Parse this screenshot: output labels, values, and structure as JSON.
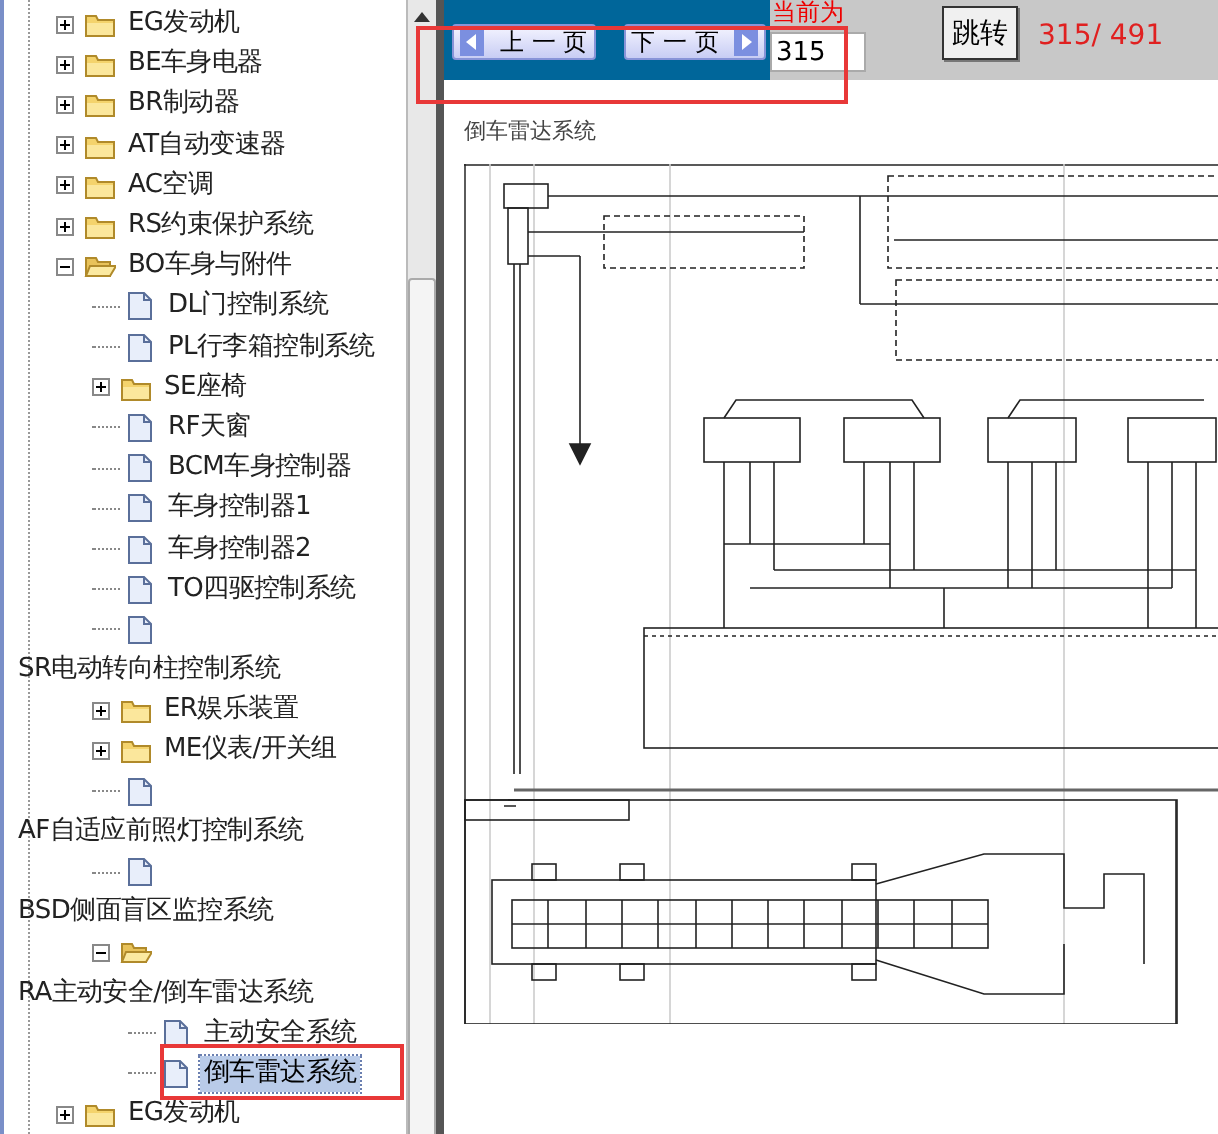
{
  "tree": {
    "items": [
      {
        "kind": "folder",
        "label": "EG发动机",
        "expanded": false,
        "selected": false
      },
      {
        "kind": "folder",
        "label": "BE车身电器",
        "expanded": false,
        "selected": false
      },
      {
        "kind": "folder",
        "label": "BR制动器",
        "expanded": false,
        "selected": false
      },
      {
        "kind": "folder",
        "label": "AT自动变速器",
        "expanded": false,
        "selected": false
      },
      {
        "kind": "folder",
        "label": "AC空调",
        "expanded": false,
        "selected": false
      },
      {
        "kind": "folder",
        "label": "RS约束保护系统",
        "expanded": false,
        "selected": false
      },
      {
        "kind": "folder",
        "label": "BO车身与附件",
        "expanded": true,
        "selected": false,
        "children": [
          {
            "kind": "doc",
            "label": "DL门控制系统",
            "selected": false
          },
          {
            "kind": "doc",
            "label": "PL行李箱控制系统",
            "selected": false
          },
          {
            "kind": "folder",
            "label": "SE座椅",
            "expanded": false,
            "selected": false
          },
          {
            "kind": "doc",
            "label": "RF天窗",
            "selected": false
          },
          {
            "kind": "doc",
            "label": "BCM车身控制器",
            "selected": false
          },
          {
            "kind": "doc",
            "label": "车身控制器1",
            "selected": false
          },
          {
            "kind": "doc",
            "label": "车身控制器2",
            "selected": false
          },
          {
            "kind": "doc",
            "label": "TO四驱控制系统",
            "selected": false
          },
          {
            "kind": "doc"
          }
        ]
      },
      {
        "kind": "heading",
        "label": "SR电动转向柱控制系统",
        "selected": false,
        "children": [
          {
            "kind": "folder",
            "label": "ER娱乐装置",
            "expanded": false,
            "selected": false
          },
          {
            "kind": "folder",
            "label": "ME仪表/开关组",
            "expanded": false,
            "selected": false
          },
          {
            "kind": "doc"
          }
        ]
      },
      {
        "kind": "heading",
        "label": "AF自适应前照灯控制系统",
        "selected": false,
        "children": [
          {
            "kind": "doc"
          }
        ]
      },
      {
        "kind": "heading",
        "label": "BSD侧面盲区监控系统",
        "selected": false,
        "children": [
          {
            "kind": "folder",
            "expanded": true,
            "children": [
              {
                "kind": "heading",
                "label": "RA主动安全/倒车雷达系统",
                "selected": false
              },
              {
                "kind": "doc",
                "label": "主动安全系统",
                "selected": false
              },
              {
                "kind": "doc",
                "label": "倒车雷达系统",
                "selected": true
              }
            ]
          }
        ]
      },
      {
        "kind": "folder",
        "label": "EG发动机",
        "expanded": false,
        "selected": false
      }
    ]
  },
  "toolbar": {
    "prev_button": {
      "label": "上 一 页"
    },
    "next_button": {
      "label": "下 一 页"
    },
    "current_label": "当前为",
    "page_field": {
      "value": "315"
    },
    "jump_button": {
      "label": "跳转"
    },
    "page_count": "315/ 491"
  },
  "document": {
    "title": "倒车雷达系统"
  }
}
